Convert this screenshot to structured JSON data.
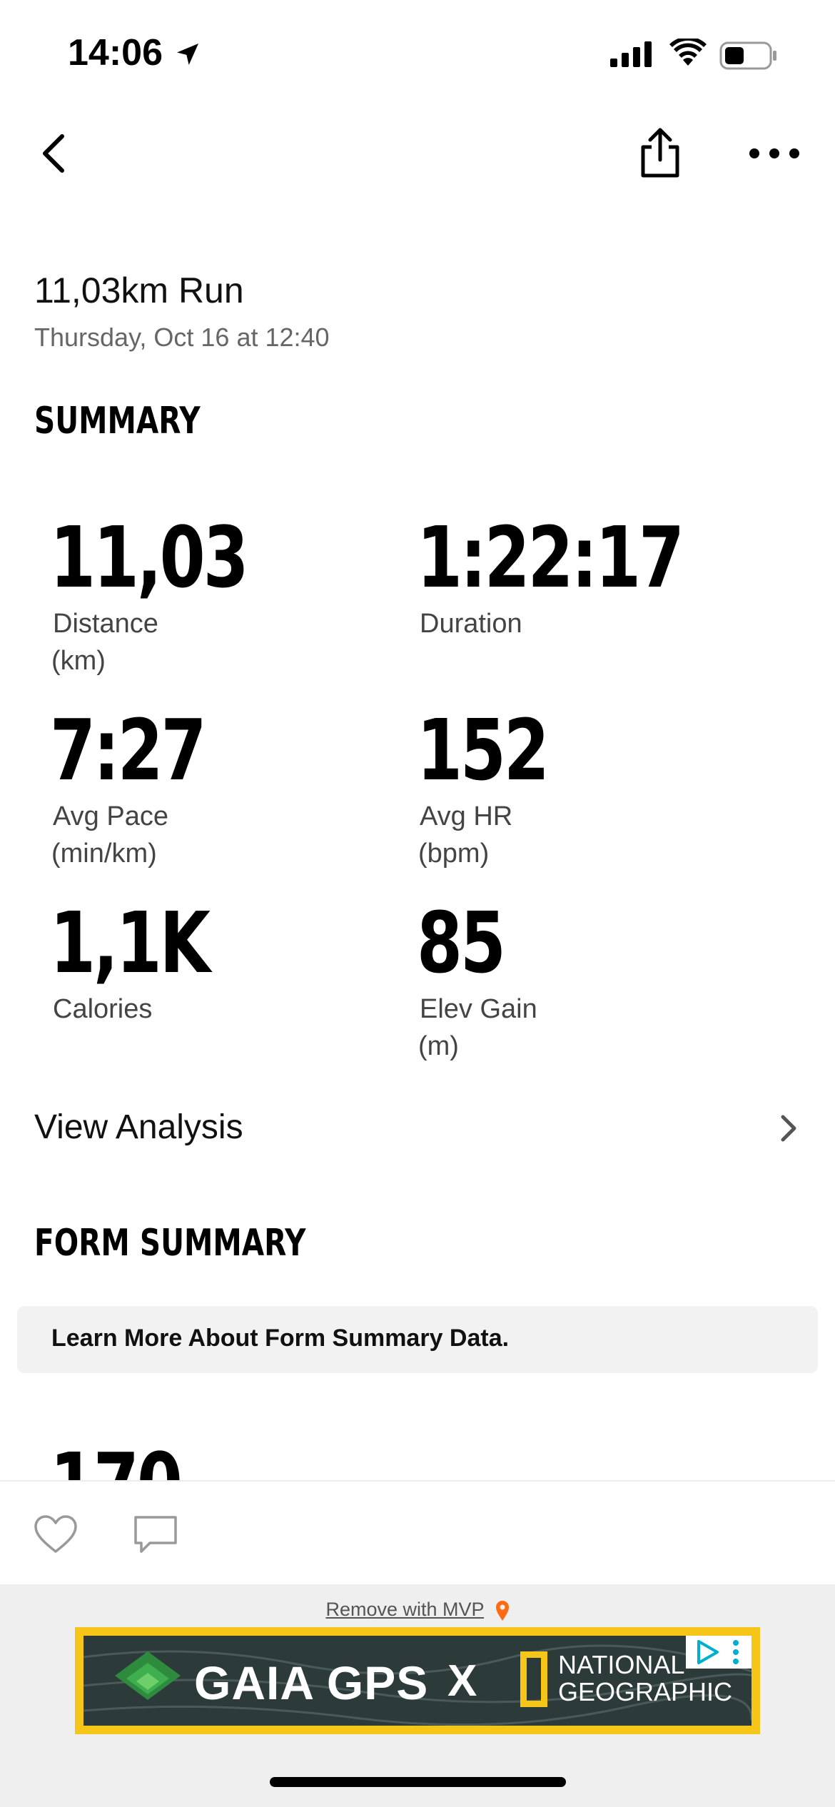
{
  "status_bar": {
    "time": "14:06"
  },
  "activity": {
    "title": "11,03km Run",
    "date": "Thursday, Oct 16 at 12:40"
  },
  "summary": {
    "heading": "SUMMARY",
    "stats": [
      {
        "value": "11,03",
        "label": "Distance",
        "unit": "(km)"
      },
      {
        "value": "1:22:17",
        "label": "Duration",
        "unit": ""
      },
      {
        "value": "7:27",
        "label": "Avg Pace",
        "unit": "(min/km)"
      },
      {
        "value": "152",
        "label": "Avg HR",
        "unit": "(bpm)"
      },
      {
        "value": "1,1K",
        "label": "Calories",
        "unit": ""
      },
      {
        "value": "85",
        "label": "Elev Gain",
        "unit": "(m)"
      }
    ]
  },
  "view_analysis": {
    "label": "View Analysis"
  },
  "form_summary": {
    "heading": "FORM SUMMARY",
    "learn_more": "Learn More About Form Summary Data.",
    "next_value_peek": "170"
  },
  "ad": {
    "remove_text": "Remove with MVP",
    "brand": "GAIA GPS",
    "separator": "X",
    "partner_line1": "NATIONAL",
    "partner_line2": "GEOGRAPHIC"
  },
  "colors": {
    "ad_border": "#f5c518",
    "mvp_pin": "#ff6a13",
    "secondary_text": "#666666"
  },
  "icons": [
    "location-arrow-icon",
    "signal-icon",
    "wifi-icon",
    "battery-icon",
    "back-chevron-icon",
    "share-icon",
    "more-dots-icon",
    "chevron-right-icon",
    "heart-icon",
    "comment-icon",
    "map-pin-icon",
    "ad-choices-icon"
  ]
}
